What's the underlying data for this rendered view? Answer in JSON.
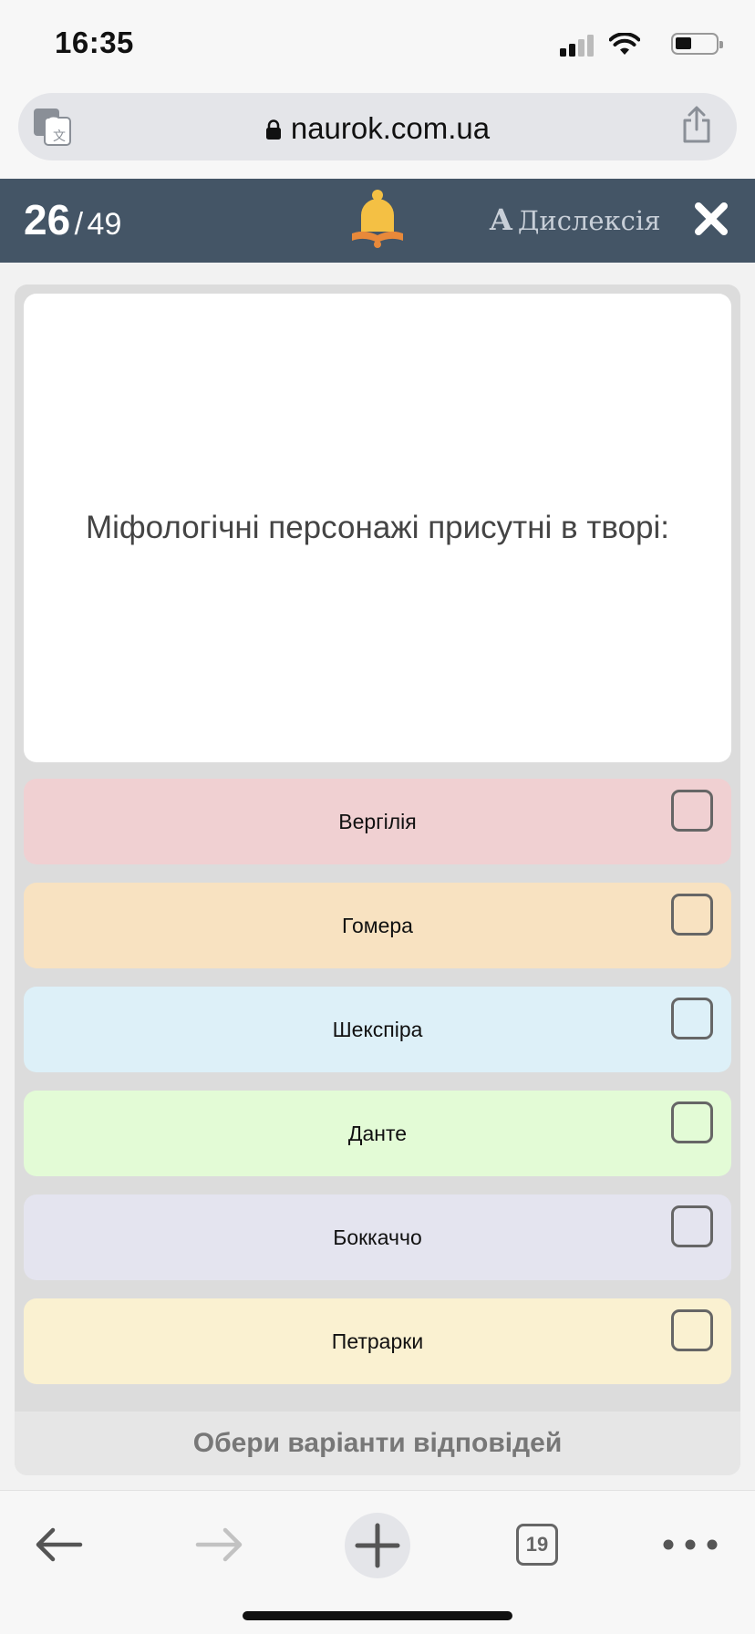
{
  "status_bar": {
    "time": "16:35"
  },
  "browser": {
    "url": "naurok.com.ua",
    "tabs_count": "19"
  },
  "quiz_header": {
    "current": "26",
    "separator": "/",
    "total": "49",
    "dyslexia_letter": "A",
    "dyslexia_label": "Дислексія"
  },
  "question": {
    "text": "Міфологічні персонажі присутні в творі:"
  },
  "options": [
    {
      "label": "Вергілія",
      "color": "#f0d0d2"
    },
    {
      "label": "Гомера",
      "color": "#f8e2c1"
    },
    {
      "label": "Шекспіра",
      "color": "#ddf0f8"
    },
    {
      "label": "Данте",
      "color": "#e3fbd6"
    },
    {
      "label": "Боккаччо",
      "color": "#e4e4ef"
    },
    {
      "label": "Петрарки",
      "color": "#faf1d1"
    }
  ],
  "submit": {
    "label": "Обери варіанти відповідей"
  },
  "colors": {
    "header_bg": "#445566",
    "bell_yellow": "#f4c044",
    "bell_orange": "#e8893a"
  }
}
